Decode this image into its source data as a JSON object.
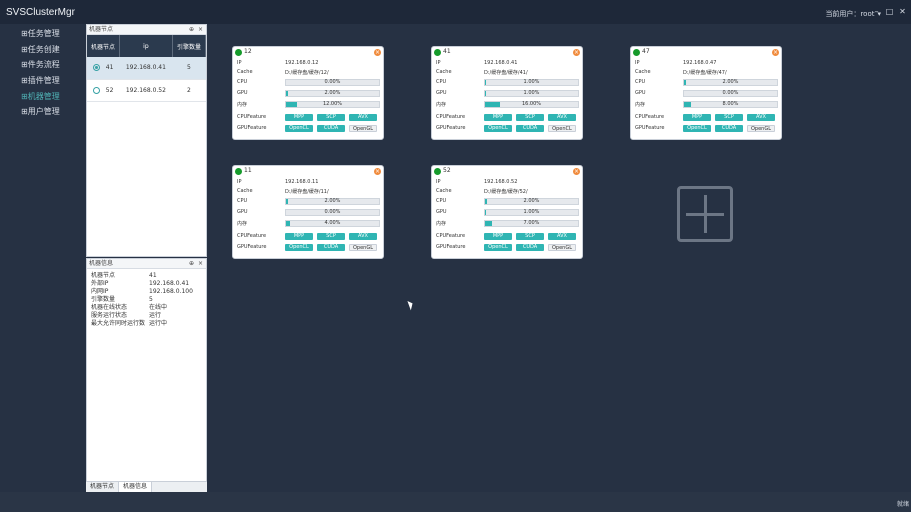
{
  "app_title": "SVSClusterMgr",
  "user": {
    "label": "当前用户：",
    "name": "root",
    "caret": "▾"
  },
  "window_buttons": [
    "–",
    "□",
    "✕"
  ],
  "nav": [
    {
      "label": "⊞任务管理"
    },
    {
      "label": "⊞任务创建"
    },
    {
      "label": "⊞件务流程"
    },
    {
      "label": "⊞插件管理"
    },
    {
      "label": "⊞机器管理"
    },
    {
      "label": "⊞用户管理"
    }
  ],
  "nodes_panel": {
    "title": "机器节点",
    "pin": "⊕",
    "close": "×",
    "columns": [
      "机器节点",
      "ip",
      "引擎数量"
    ],
    "rows": [
      {
        "node": "41",
        "ip": "192.168.0.41",
        "engines": "5",
        "selected": true
      },
      {
        "node": "52",
        "ip": "192.168.0.52",
        "engines": "2",
        "selected": false
      }
    ]
  },
  "info_panel": {
    "title": "机器信息",
    "pin": "⊕",
    "close": "×",
    "rows": [
      {
        "k": "机器节点",
        "v": "41"
      },
      {
        "k": "外部IP",
        "v": "192.168.0.41"
      },
      {
        "k": "内网IP",
        "v": "192.168.0.100"
      },
      {
        "k": "引擎数量",
        "v": "5"
      },
      {
        "k": "机器在线状态",
        "v": "在线中"
      },
      {
        "k": "服务运行状态",
        "v": "运行"
      },
      {
        "k": "最大允许同时运行数",
        "v": "运行中"
      }
    ]
  },
  "tabs": [
    "机器节点",
    "机器信息"
  ],
  "cards": [
    {
      "id": "12",
      "ip": "192.168.0.12",
      "cache": "D:/缓存盘/缓存/12/",
      "cpu": "0.00%",
      "cpu_level": 0.0,
      "gpu": "2.00%",
      "gpu_level": 0.02,
      "mem": "12.00%",
      "mem_level": 0.12,
      "cuda": [
        "MPP",
        "SCP",
        "AVX"
      ],
      "graphics": [
        "OpenCL",
        "CUDA",
        "OpenGL"
      ],
      "show_cache": true
    },
    {
      "id": "41",
      "ip": "192.168.0.41",
      "cache": "D:/缓存盘/缓存/41/",
      "cpu": "1.00%",
      "cpu_level": 0.01,
      "gpu": "1.00%",
      "gpu_level": 0.01,
      "mem": "16.00%",
      "mem_level": 0.16,
      "cuda": [
        "MPP",
        "SCP",
        "AVX"
      ],
      "graphics": [
        "OpenCL",
        "CUDA",
        "OpenCL"
      ],
      "show_cache": true
    },
    {
      "id": "47",
      "ip": "192.168.0.47",
      "cache": "D:/缓存盘/缓存/47/",
      "cpu": "2.00%",
      "cpu_level": 0.02,
      "gpu": "0.00%",
      "gpu_level": 0.0,
      "mem": "8.00%",
      "mem_level": 0.08,
      "cuda": [
        "MPP",
        "SCP",
        "AVX"
      ],
      "graphics": [
        "OpenCL",
        "CUDA",
        "OpenGL"
      ],
      "show_cache": true
    },
    {
      "id": "11",
      "ip": "192.168.0.11",
      "cache": "D:/缓存盘/缓存/11/",
      "cpu": "2.00%",
      "cpu_level": 0.02,
      "gpu": "0.00%",
      "gpu_level": 0.0,
      "mem": "4.00%",
      "mem_level": 0.04,
      "cuda": [
        "MPP",
        "SCP",
        "AVX"
      ],
      "graphics": [
        "OpenCL",
        "CUDA",
        "OpenGL"
      ],
      "show_cache": true
    },
    {
      "id": "52",
      "ip": "192.168.0.52",
      "cache": "D:/缓存盘/缓存/52/",
      "cpu": "2.00%",
      "cpu_level": 0.02,
      "gpu": "1.00%",
      "gpu_level": 0.01,
      "mem": "7.00%",
      "mem_level": 0.07,
      "cuda": [
        "MPP",
        "SCP",
        "AVX"
      ],
      "graphics": [
        "OpenCL",
        "CUDA",
        "OpenGL"
      ],
      "show_cache": true
    }
  ],
  "card_labels": {
    "ip": "IP",
    "cache": "Cache",
    "cpu": "CPU",
    "gpu": "GPU",
    "mem": "内存",
    "cpu_feature": "CPUFeature",
    "gpu_feature": "GPUFeature"
  },
  "status_text": "就绪"
}
